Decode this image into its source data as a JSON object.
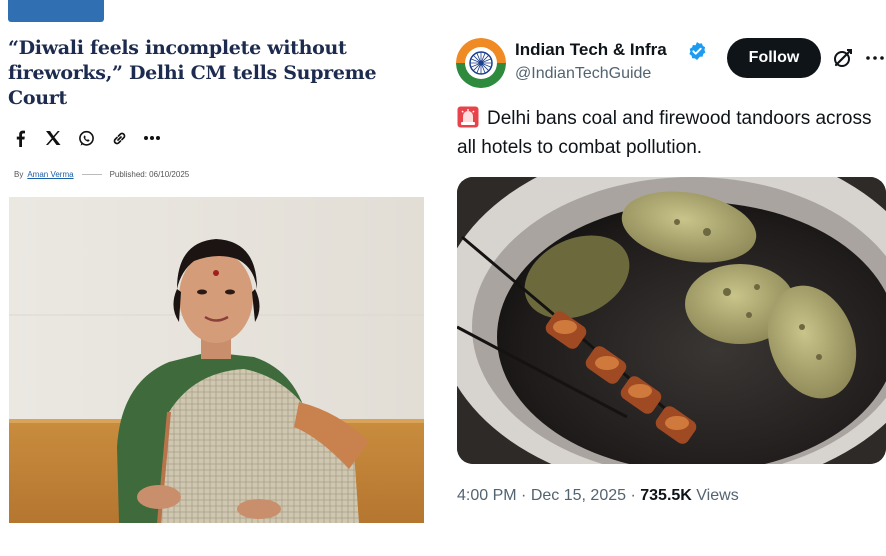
{
  "article": {
    "section_tag": "",
    "headline": "“Diwali feels incomplete without fireworks,” Delhi CM tells Supreme Court",
    "byline_prefix": "By",
    "author": "Aman Verma",
    "published": "Published: 06/10/2025",
    "share_icons": [
      "facebook-icon",
      "x-icon",
      "whatsapp-icon",
      "link-icon",
      "more-icon"
    ]
  },
  "tweet": {
    "name": "Indian Tech & Infra",
    "handle": "@IndianTechGuide",
    "follow_label": "Follow",
    "text": "Delhi bans coal and firewood tandoors across all hotels to combat pollution.",
    "text_icon": "siren-icon",
    "time": "4:00 PM",
    "date": "Dec 15, 2025",
    "separator": "·",
    "views_count": "735.5K",
    "views_label": "Views"
  },
  "colors": {
    "headline": "#1d2b4f",
    "tag": "#2f6fb2",
    "follow_bg": "#0f1419",
    "verified": "#1d9bf0",
    "secondary_text": "#536471"
  }
}
